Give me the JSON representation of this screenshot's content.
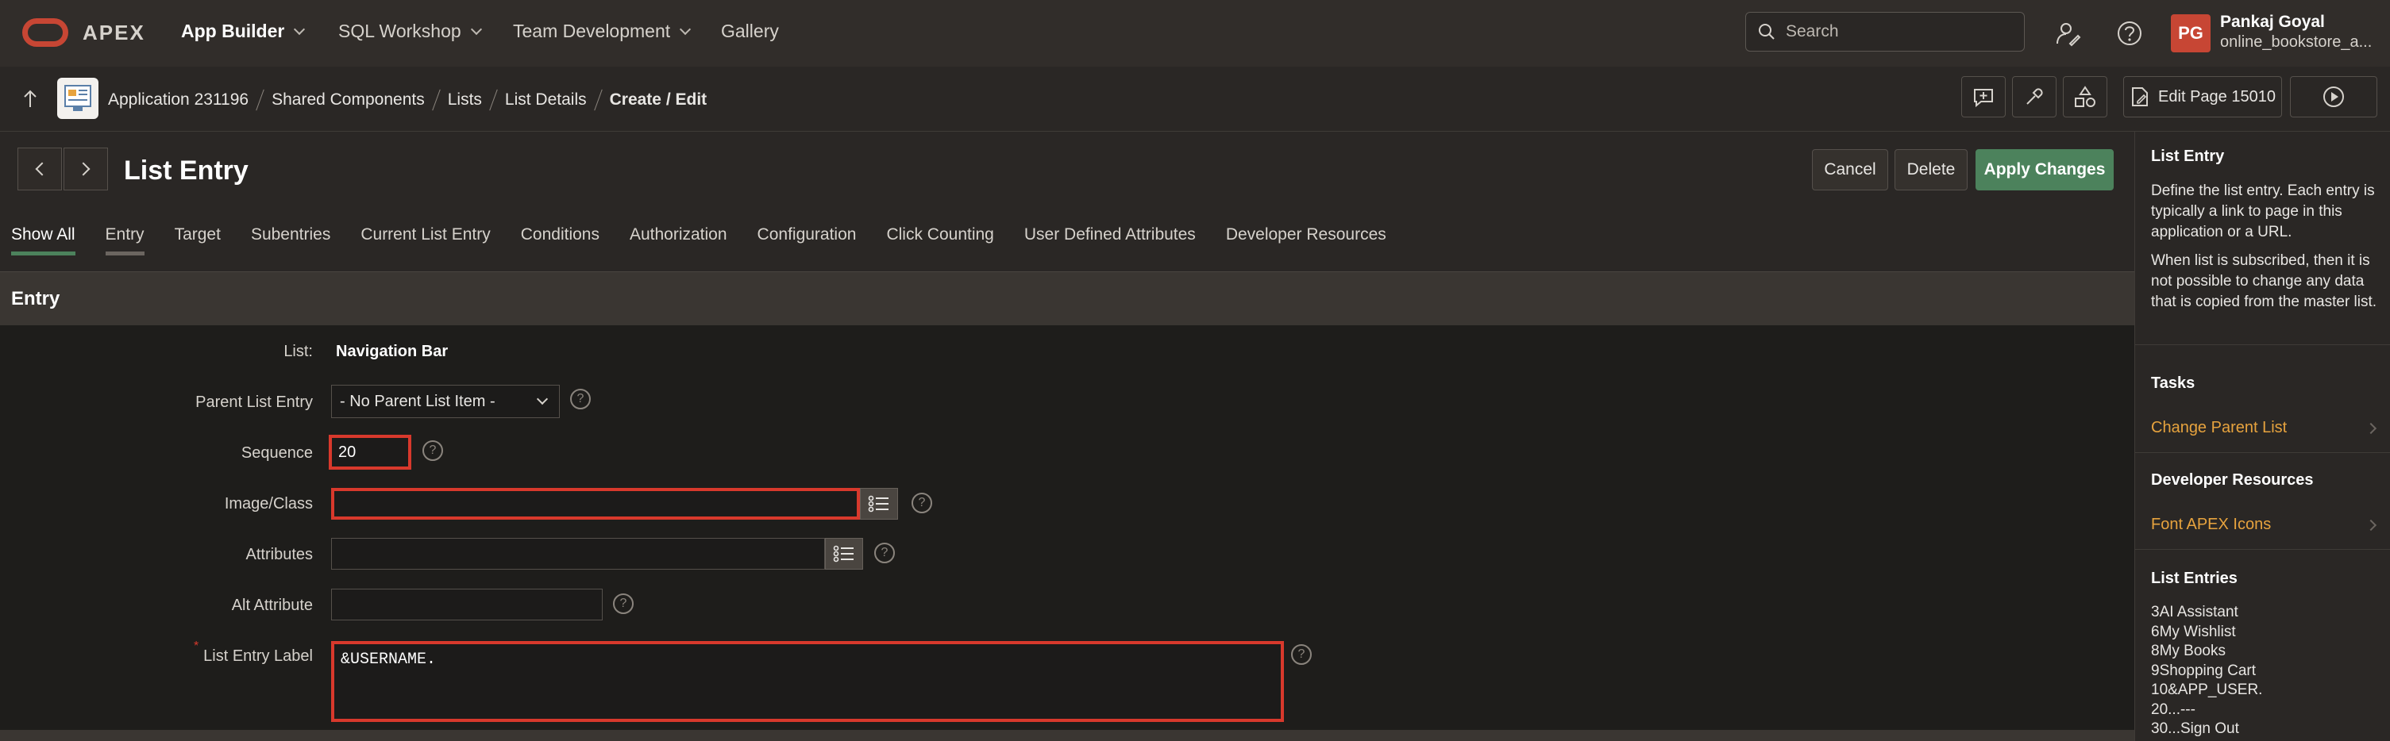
{
  "header": {
    "brand": "APEX",
    "nav": [
      {
        "label": "App Builder",
        "active": true,
        "has_menu": true
      },
      {
        "label": "SQL Workshop",
        "active": false,
        "has_menu": true
      },
      {
        "label": "Team Development",
        "active": false,
        "has_menu": true
      },
      {
        "label": "Gallery",
        "active": false,
        "has_menu": false
      }
    ],
    "search_placeholder": "Search",
    "user": {
      "initials": "PG",
      "name": "Pankaj Goyal",
      "workspace": "online_bookstore_a..."
    }
  },
  "breadcrumb": {
    "items": [
      "Application 231196",
      "Shared Components",
      "Lists",
      "List Details",
      "Create / Edit"
    ],
    "edit_page_label": "Edit Page 15010"
  },
  "page": {
    "title": "List Entry",
    "buttons": {
      "cancel": "Cancel",
      "delete": "Delete",
      "apply": "Apply Changes"
    },
    "tabs": [
      "Show All",
      "Entry",
      "Target",
      "Subentries",
      "Current List Entry",
      "Conditions",
      "Authorization",
      "Configuration",
      "Click Counting",
      "User Defined Attributes",
      "Developer Resources"
    ],
    "active_tab": "Show All"
  },
  "section": {
    "title": "Entry",
    "fields": {
      "list_label": "List:",
      "list_value": "Navigation Bar",
      "parent_label": "Parent List Entry",
      "parent_value": "- No Parent List Item -",
      "sequence_label": "Sequence",
      "sequence_value": "20",
      "image_label": "Image/Class",
      "image_value": "",
      "attributes_label": "Attributes",
      "attributes_value": "",
      "alt_label": "Alt Attribute",
      "alt_value": "",
      "entry_label_label": "List Entry Label",
      "entry_label_value": "&USERNAME."
    }
  },
  "right_panel": {
    "help_title": "List Entry",
    "help_p1": "Define the list entry. Each entry is typically a link to page in this application or a URL.",
    "help_p2": "When list is subscribed, then it is not possible to change any data that is copied from the master list.",
    "tasks_title": "Tasks",
    "tasks_link": "Change Parent List",
    "dev_title": "Developer Resources",
    "dev_link": "Font APEX Icons",
    "entries_title": "List Entries",
    "entries": [
      "3AI Assistant",
      "6My Wishlist",
      "8My Books",
      "9Shopping Cart",
      "10&APP_USER.",
      "20...---",
      "30...Sign Out"
    ]
  },
  "colors": {
    "accent_green": "#4c825c",
    "oracle_red": "#c74634",
    "highlight_red": "#d8392c",
    "link_orange": "#e7a33e"
  }
}
